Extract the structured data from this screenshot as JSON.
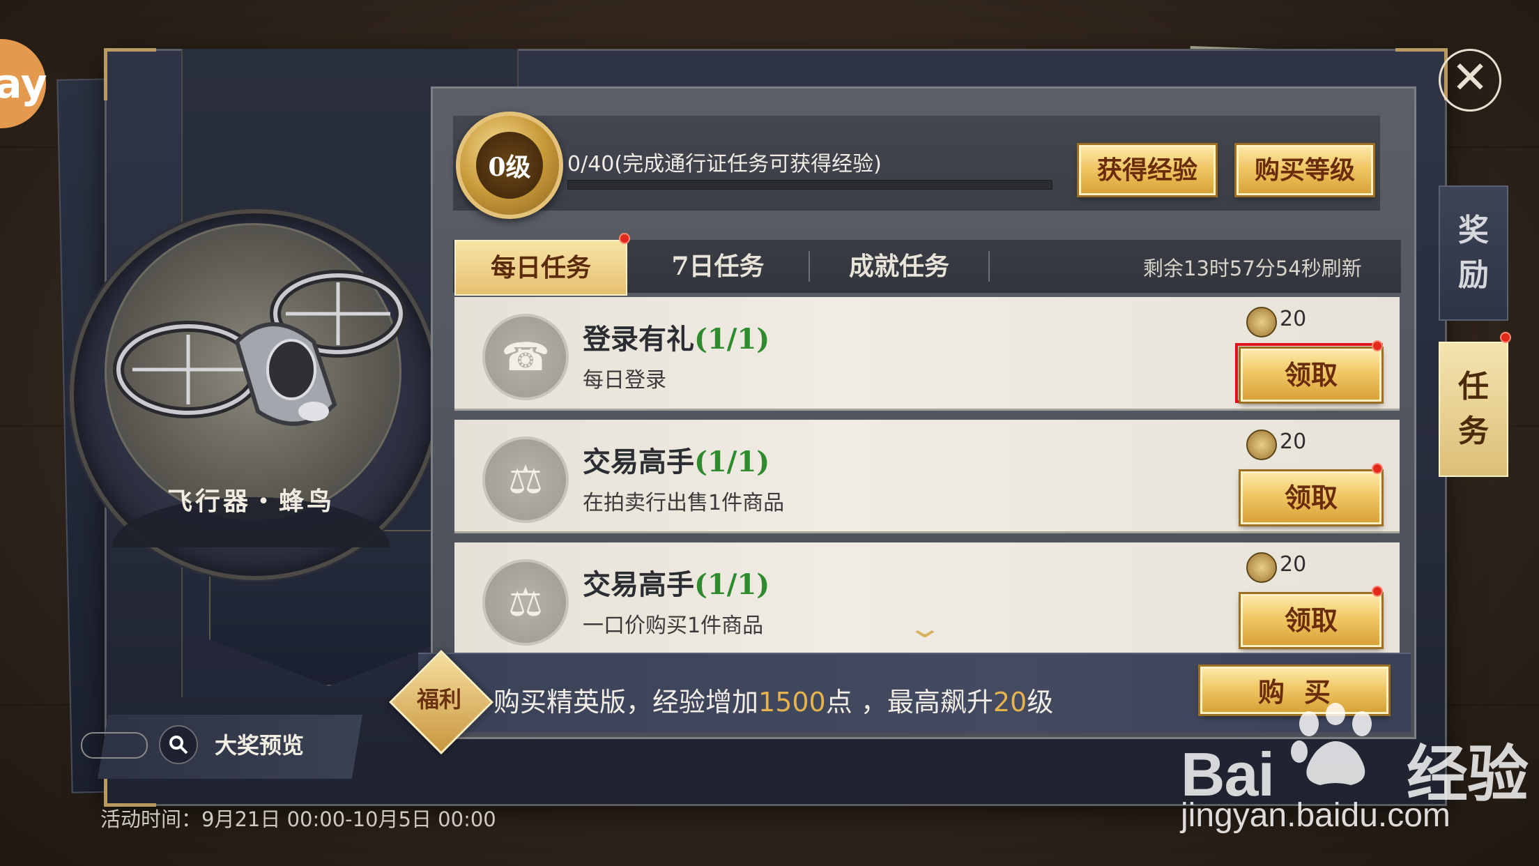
{
  "header": {
    "level_badge": "0级",
    "exp_text": "0/40(完成通行证任务可获得经验)",
    "exp_progress": 0,
    "get_exp_label": "获得经验",
    "buy_level_label": "购买等级"
  },
  "tabs": [
    {
      "label": "每日任务",
      "active": true,
      "has_badge": true
    },
    {
      "label": "7日任务",
      "active": false,
      "has_badge": false
    },
    {
      "label": "成就任务",
      "active": false,
      "has_badge": false
    }
  ],
  "refresh_text": "剩余13时57分54秒刷新",
  "tasks": [
    {
      "title": "登录有礼",
      "progress": "(1/1)",
      "desc": "每日登录",
      "reward": "20",
      "claim_label": "领取",
      "icon": "phone-hand-icon",
      "highlighted": true
    },
    {
      "title": "交易高手",
      "progress": "(1/1)",
      "desc": "在拍卖行出售1件商品",
      "reward": "20",
      "claim_label": "领取",
      "icon": "gavel-icon",
      "highlighted": false
    },
    {
      "title": "交易高手",
      "progress": "(1/1)",
      "desc": "一口价购买1件商品",
      "reward": "20",
      "claim_label": "领取",
      "icon": "gavel-icon",
      "highlighted": false
    }
  ],
  "side_tabs": {
    "reward": [
      "奖",
      "励"
    ],
    "task": [
      "任",
      "务"
    ]
  },
  "left_panel": {
    "item_name": "飞行器・蜂鸟",
    "preview_label": "大奖预览",
    "event_time": "活动时间：9月21日 00:00-10月5日 00:00"
  },
  "bonus": {
    "tag": "福利",
    "text_a": "购买精英版，经验增加",
    "num_a": "1500",
    "text_b": "点 ，最高飙升",
    "num_b": "20",
    "text_c": "级",
    "buy_label": "购买"
  },
  "watermark": {
    "logo": "Bai",
    "logo_tail": "经验",
    "url": "jingyan.baidu.com"
  },
  "colors": {
    "gold_button": "#f0c765",
    "progress_green": "#2e8b2e",
    "badge_red": "#e12a1c",
    "bonus_number": "#e5b24d"
  }
}
